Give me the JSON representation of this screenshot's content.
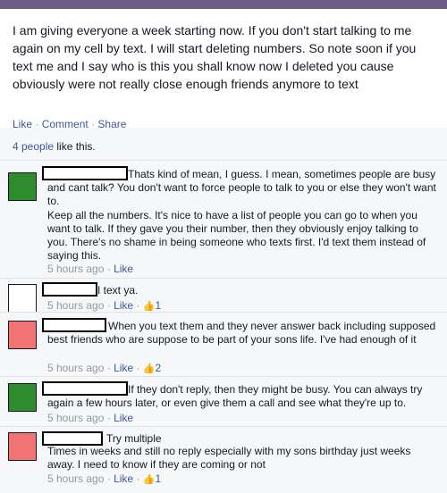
{
  "colors": {
    "accent": "#3b5998",
    "green_avatar": "#2e8b2e",
    "red_avatar": "#f27474",
    "white_avatar": "#ffffff"
  },
  "post": {
    "text": "I am giving everyone a week starting now. If you don't start talking to me again on my cell by text. I will start deleting numbers. So note soon if you text me and I say who is this you shall know now I deleted you cause obviously were not really close enough friends anymore to text",
    "actions": {
      "like": "Like",
      "comment": "Comment",
      "share": "Share",
      "separator": "·"
    }
  },
  "likes": {
    "count_text": "4 people",
    "rest_text": " like this."
  },
  "comments": [
    {
      "avatar_color": "green",
      "text_first": "Thats kind of mean, I guess. I mean, sometimes people are busy and cant talk? You don't want to force people to talk to you or else they won't want to.",
      "text_second": "Keep all the numbers. It's nice to have a list of people you can go to when you want to talk. If they gave you their number, then they obviously enjoy talking to you. There's no shame in being someone who texts first. I'd text them instead of saying this.",
      "time": "5 hours ago",
      "like": "Like",
      "like_count": ""
    },
    {
      "avatar_color": "white",
      "text_first": "I text ya.",
      "time": "5 hours ago",
      "like": "Like",
      "like_count": "1"
    },
    {
      "avatar_color": "red",
      "text_first": "When you text them and they never answer back including supposed best friends who are suppose to be part of your sons life. I've had enough of it",
      "time": "5 hours ago",
      "like": "Like",
      "like_count": "2"
    },
    {
      "avatar_color": "green",
      "text_first": "If they don't reply, then they might be busy. You can always try again a few hours later, or even give them a call and see what they're up to.",
      "time": "5 hours ago",
      "like": "Like",
      "like_count": ""
    },
    {
      "avatar_color": "red",
      "text_first": "Try multiple",
      "text_second": "Times in weeks and still no reply especially with my sons birthday just weeks away. I need to know if they are coming or not",
      "time": "5 hours ago",
      "like": "Like",
      "like_count": "1"
    }
  ]
}
